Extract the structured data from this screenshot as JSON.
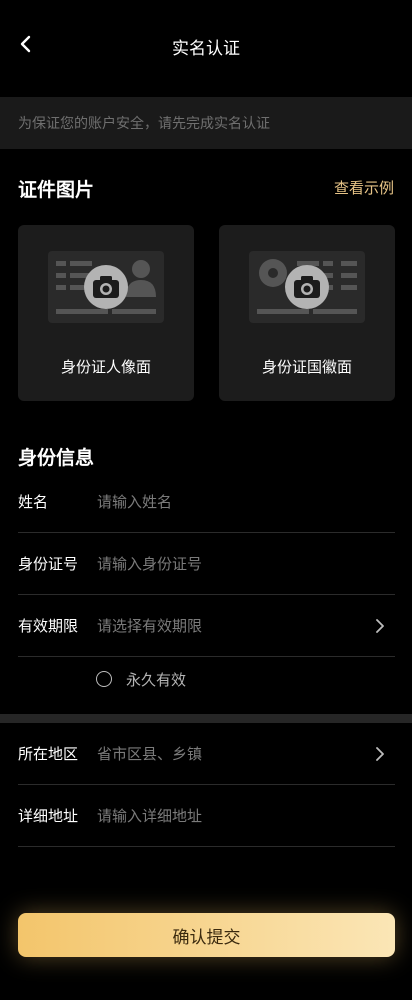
{
  "header": {
    "title": "实名认证"
  },
  "notice": {
    "text": "为保证您的账户安全，请先完成实名认证"
  },
  "id_photos": {
    "title": "证件图片",
    "example_link": "查看示例",
    "front_label": "身份证人像面",
    "back_label": "身份证国徽面"
  },
  "identity": {
    "title": "身份信息",
    "name_label": "姓名",
    "name_placeholder": "请输入姓名",
    "id_label": "身份证号",
    "id_placeholder": "请输入身份证号",
    "validity_label": "有效期限",
    "validity_placeholder": "请选择有效期限",
    "permanent_label": "永久有效"
  },
  "address": {
    "region_label": "所在地区",
    "region_placeholder": "省市区县、乡镇",
    "detail_label": "详细地址",
    "detail_placeholder": "请输入详细地址"
  },
  "submit_label": "确认提交",
  "colors": {
    "background": "#000000",
    "accent": "#e7c487",
    "button_gradient_start": "#f3c56b",
    "button_gradient_end": "#fbe6b6"
  }
}
